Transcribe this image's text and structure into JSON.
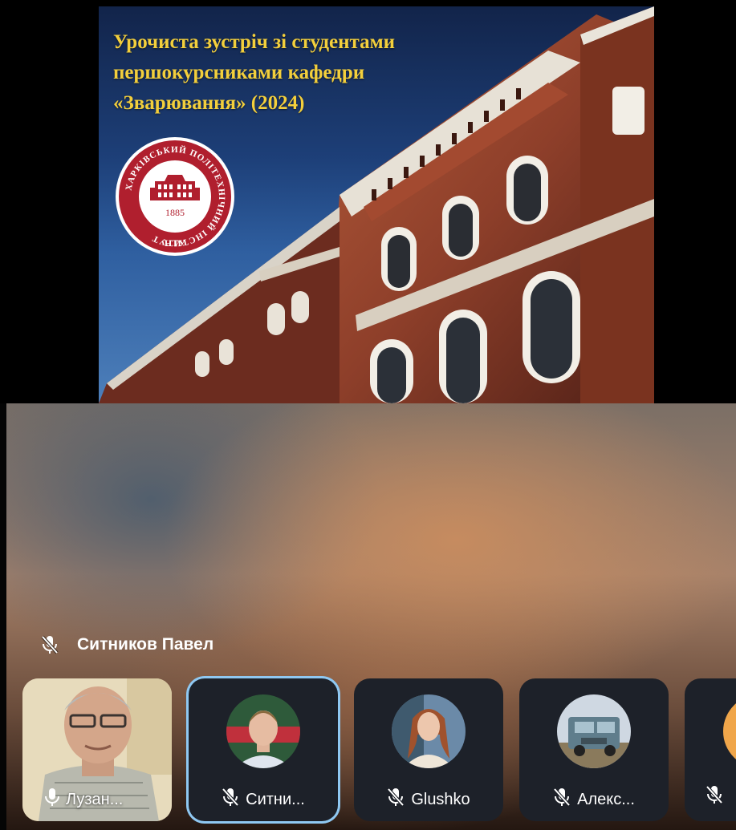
{
  "slide": {
    "title_lines": [
      "Урочиста зустріч зі студентами",
      "першокурсниками кафедри",
      "«Зварювання» (2024)"
    ],
    "seal": {
      "ring_text": "ХАРКІВСЬКИЙ ПОЛІТЕХНІЧНИЙ ІНСТИТУТ",
      "year": "1885",
      "abbr": "НТУ"
    }
  },
  "speaker": {
    "name": "Ситников Павел",
    "mic_icon": "mic-off-icon"
  },
  "participants": [
    {
      "label": "Лузан...",
      "mic_icon": "mic-on-icon",
      "kind": "video"
    },
    {
      "label": "Ситни...",
      "mic_icon": "mic-off-icon",
      "kind": "avatar",
      "active": true
    },
    {
      "label": "Glushko",
      "mic_icon": "mic-off-icon",
      "kind": "avatar"
    },
    {
      "label": "Алекс...",
      "mic_icon": "mic-off-icon",
      "kind": "avatar"
    },
    {
      "label": "",
      "mic_icon": "mic-off-icon",
      "kind": "avatar"
    }
  ],
  "colors": {
    "title_gold": "#f3cf3c",
    "seal_red": "#b01f2e",
    "brick": "#8e3f2a",
    "active_ring": "#8fc8f2",
    "tile_bg": "#1d2129"
  }
}
